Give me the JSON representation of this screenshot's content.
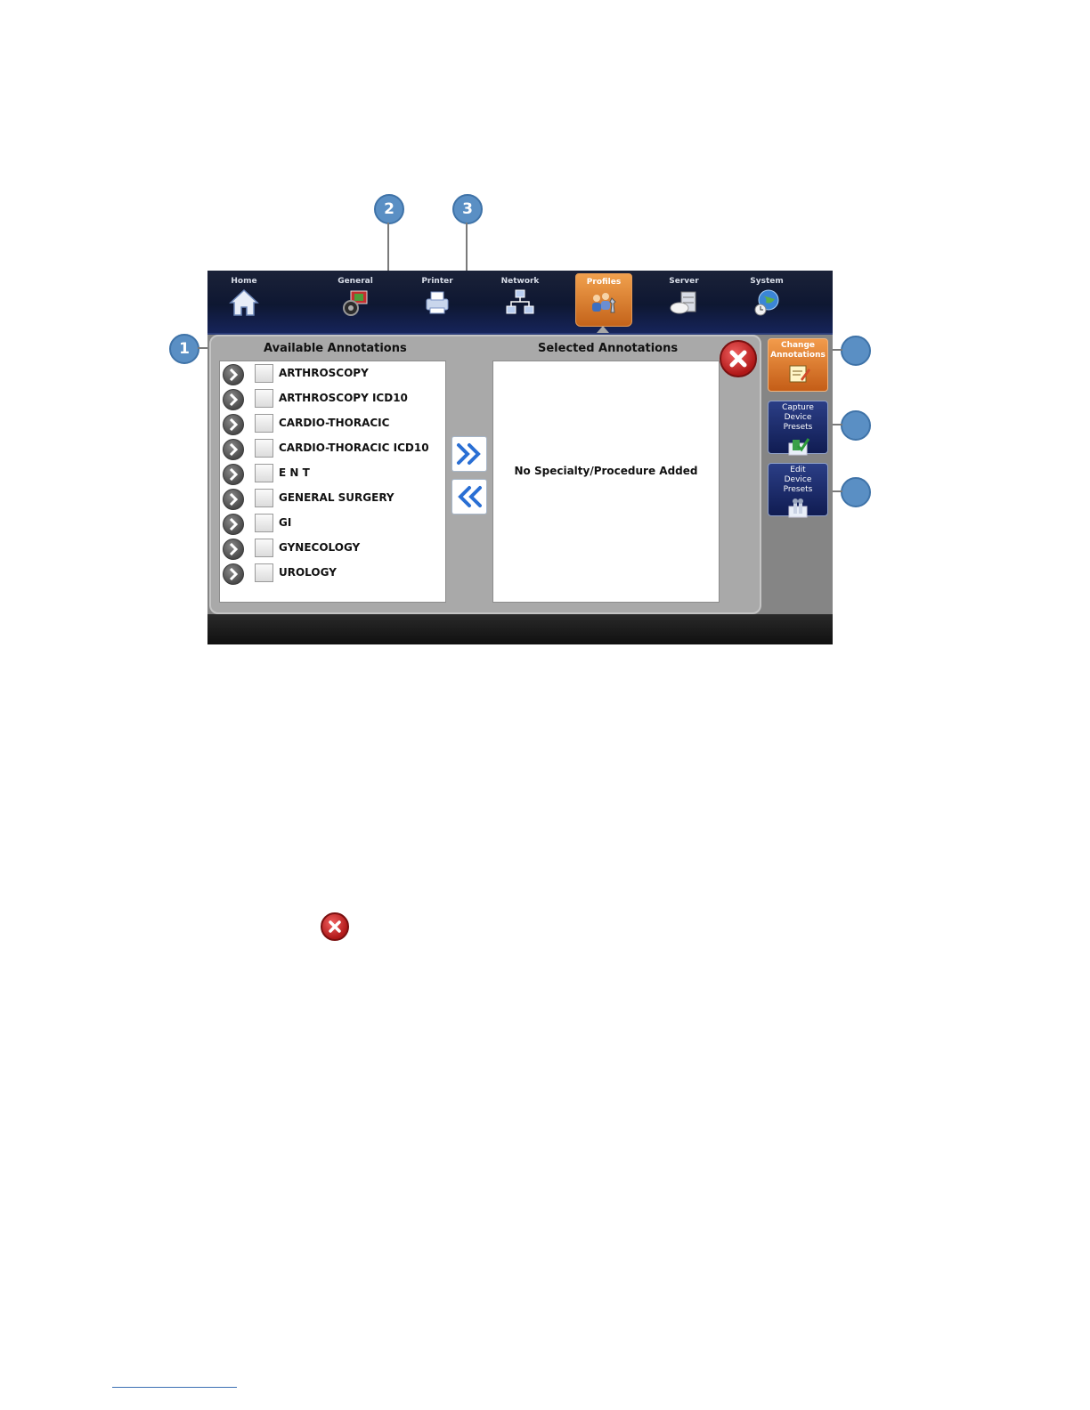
{
  "callouts": [
    "1",
    "2",
    "3"
  ],
  "nav": {
    "items": [
      {
        "label": "Home",
        "icon": "home-icon"
      },
      {
        "label": "General",
        "icon": "general-icon"
      },
      {
        "label": "Printer",
        "icon": "printer-icon"
      },
      {
        "label": "Network",
        "icon": "network-icon"
      },
      {
        "label": "Profiles",
        "icon": "profiles-icon",
        "active": true
      },
      {
        "label": "Server",
        "icon": "server-icon"
      },
      {
        "label": "System",
        "icon": "system-icon"
      }
    ]
  },
  "available": {
    "title": "Available Annotations",
    "items": [
      "ARTHROSCOPY",
      "ARTHROSCOPY ICD10",
      "CARDIO-THORACIC",
      "CARDIO-THORACIC ICD10",
      "E N T",
      "GENERAL SURGERY",
      "GI",
      "GYNECOLOGY",
      "UROLOGY"
    ]
  },
  "selected": {
    "title": "Selected Annotations",
    "empty_message": "No Specialty/Procedure Added"
  },
  "side_buttons": [
    {
      "line1": "Change",
      "line2": "Annotations",
      "style": "orange"
    },
    {
      "line1": "Capture",
      "line2": "Device Presets",
      "style": "blue"
    },
    {
      "line1": "Edit",
      "line2": "Device Presets",
      "style": "blue"
    }
  ],
  "colors": {
    "accent_orange": "#e0802f",
    "nav_dark": "#0e1732",
    "callout_blue": "#5a8fc4",
    "close_red": "#c82020"
  }
}
